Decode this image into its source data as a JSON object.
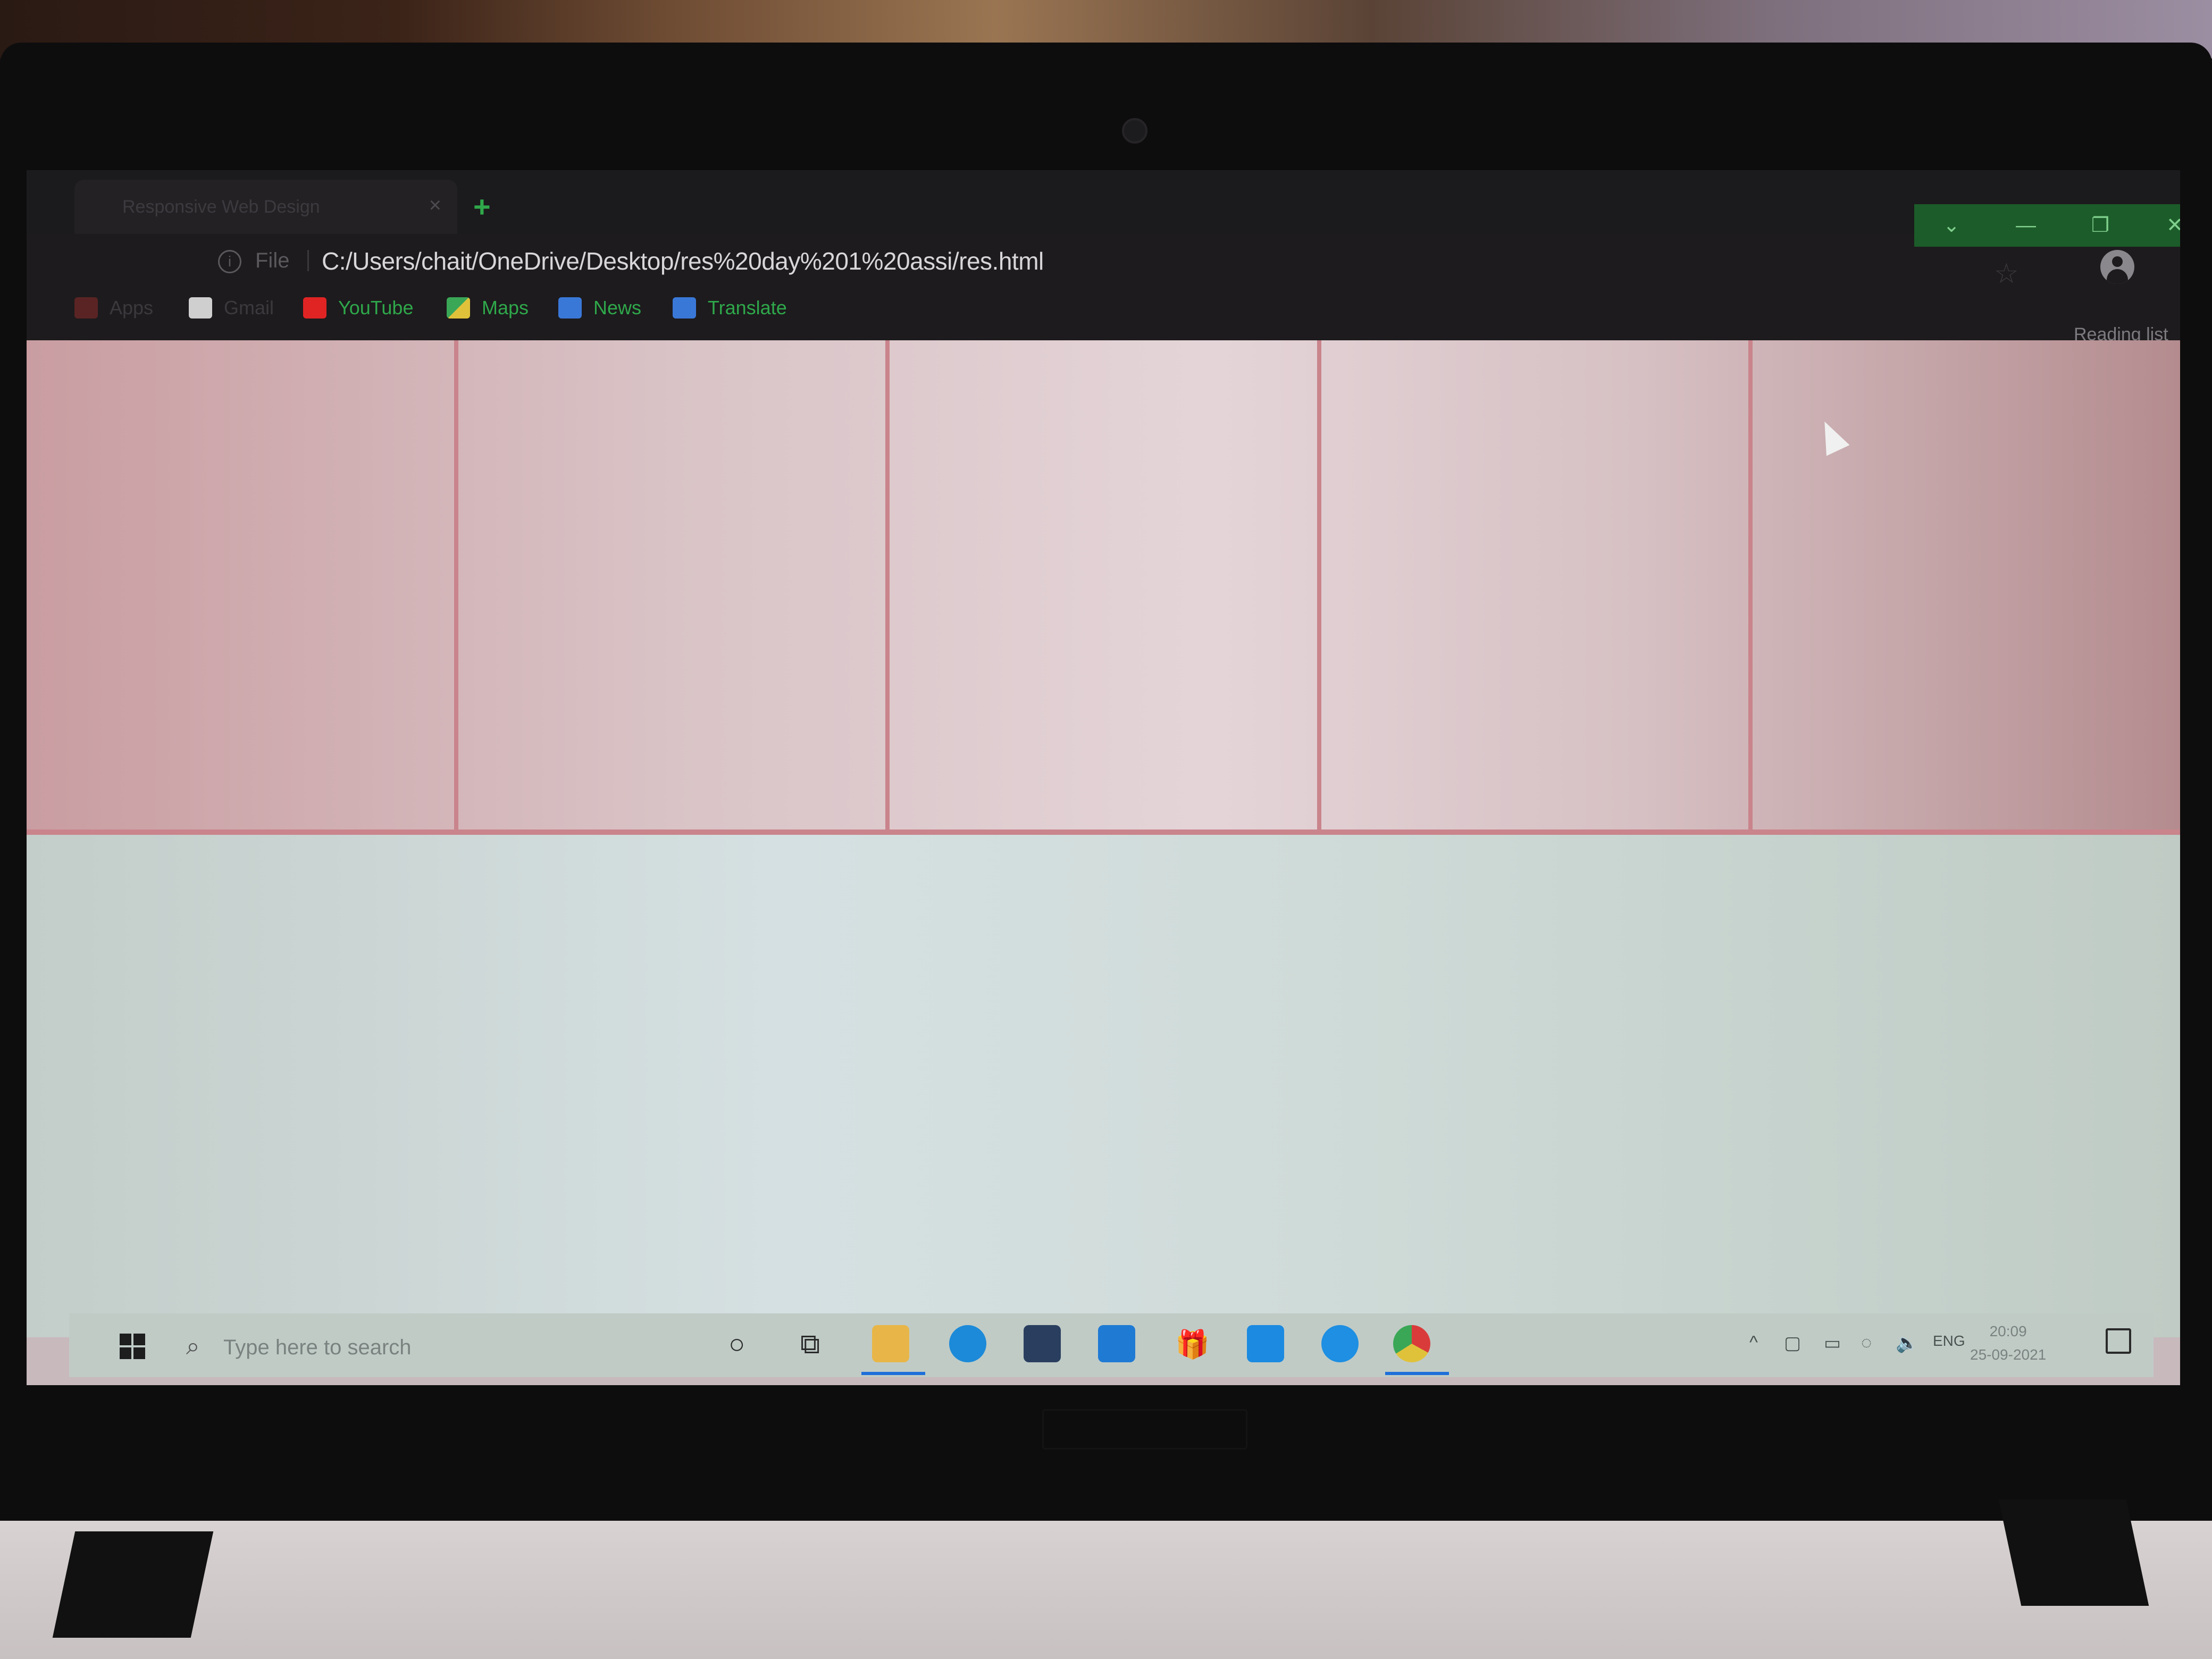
{
  "browser": {
    "tab_title": "Responsive Web Design",
    "tab_close": "×",
    "new_tab": "+",
    "address_prefix": "File",
    "url": "C:/Users/chait/OneDrive/Desktop/res%20day%201%20assi/res.html",
    "reading_list": "Reading list",
    "window_controls": [
      "⌄",
      "—",
      "❐",
      "✕"
    ]
  },
  "bookmarks": [
    {
      "label": "Apps",
      "icon": "apps-grid-icon",
      "color": "#d93b3b"
    },
    {
      "label": "Gmail",
      "icon": "gmail-icon",
      "color": "#e8e8e8"
    },
    {
      "label": "YouTube",
      "icon": "youtube-icon",
      "color": "#e02424"
    },
    {
      "label": "Maps",
      "icon": "maps-icon",
      "color": "#3aa757"
    },
    {
      "label": "News",
      "icon": "news-icon",
      "color": "#3a78d8"
    },
    {
      "label": "Translate",
      "icon": "translate-icon",
      "color": "#3a78d8"
    }
  ],
  "page": {
    "pink_boxes": 5,
    "pink_border_color": "#c9848c",
    "green_area_color": "#d5e0e2"
  },
  "taskbar": {
    "search_placeholder": "Type here to search",
    "tray_language": "ENG",
    "time": "20:09",
    "date": "25-09-2021",
    "apps": [
      "cortana-icon",
      "task-view-icon",
      "file-explorer-icon",
      "edge-icon",
      "store-icon",
      "mail-icon",
      "gift-icon",
      "whatsapp-icon",
      "skype-icon",
      "chrome-icon"
    ]
  }
}
